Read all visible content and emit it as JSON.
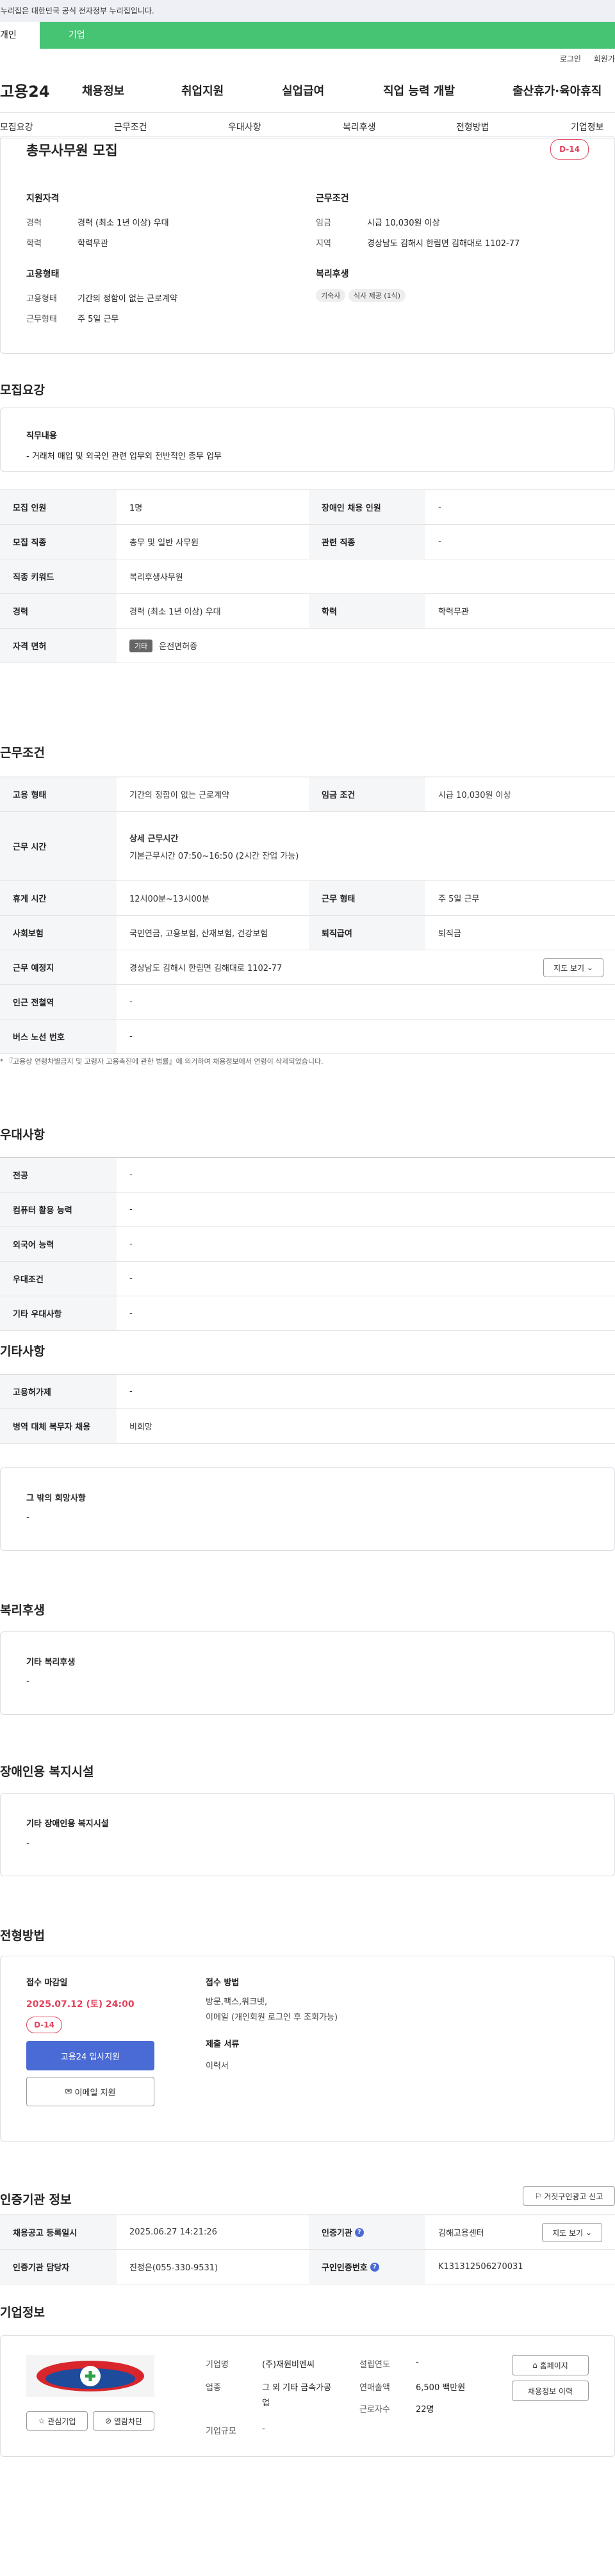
{
  "notice": "이 누리집은 대한민국 공식 전자정부 누리집입니다.",
  "user_tabs": [
    "개인",
    "기업"
  ],
  "util": {
    "login": "로그인",
    "signup": "회원가"
  },
  "logo": "고용24",
  "gnb": [
    "채용정보",
    "취업지원",
    "실업급여",
    "직업 능력 개발",
    "출산휴가·육아휴직"
  ],
  "subnav": [
    "모집요강",
    "근무조건",
    "우대사항",
    "복리후생",
    "전형방법",
    "기업정보"
  ],
  "summary": {
    "title": "총무사무원 모집",
    "dday": "D-14",
    "qual_h": "지원자격",
    "exp_l": "경력",
    "exp_v": "경력 (최소 1년 이상) 우대",
    "edu_l": "학력",
    "edu_v": "학력무관",
    "work_h": "근무조건",
    "wage_l": "임금",
    "wage_v": "시급 10,030원 이상",
    "region_l": "지역",
    "region_v": "경상남도 김해시 한림면 김해대로 1102-77",
    "emp_h": "고용형태",
    "type_l": "고용형태",
    "type_v": "기간의 정함이 없는 근로계약",
    "days_l": "근무형태",
    "days_v": "주 5일 근무",
    "welfare_h": "복리후생",
    "tags": [
      "기숙사",
      "식사 제공 (1식)"
    ]
  },
  "recruit": {
    "title": "모집요강",
    "duty_h": "직무내용",
    "duty_v": "- 거래처 매입 및 외국인 관련 업무외 전반적인 총무 업무",
    "rows": [
      [
        "모집 인원",
        "1명",
        "장애인 채용 인원",
        "-"
      ],
      [
        "모집 직종",
        "총무 및 일반 사무원",
        "관련 직종",
        "-"
      ],
      [
        "직종 키워드",
        "복리후생사무원"
      ],
      [
        "경력",
        "경력 (최소 1년 이상) 우대",
        "학력",
        "학력무관"
      ],
      [
        "자격 면허",
        "운전면허증"
      ]
    ],
    "license_tag": "기타"
  },
  "cond": {
    "title": "근무조건",
    "r1": [
      "고용 형태",
      "기간의 정함이 없는 근로계약",
      "임금 조건",
      "시급 10,030원 이상"
    ],
    "r2_h": "근무 시간",
    "r2_sub": "상세 근무시간",
    "r2_v": "기본근무시간 07:50~16:50 (2시간 잔업 가능)",
    "r3": [
      "휴게 시간",
      "12시00분~13시00분",
      "근무 형태",
      "주 5일 근무"
    ],
    "r4": [
      "사회보험",
      "국민연금, 고용보험, 산재보험, 건강보험",
      "퇴직급여",
      "퇴직금"
    ],
    "r5": [
      "근무 예정지",
      "경상남도 김해시 한림면 김해대로 1102-77"
    ],
    "map": "지도 보기",
    "r6": [
      "인근 전철역",
      "-"
    ],
    "r7": [
      "버스 노선 번호",
      "-"
    ],
    "note": "* 『고용상 연령차별금지 및 고령자 고용촉진에 관한 법률』에 의거하여 채용정보에서 연령이 삭제되었습니다."
  },
  "pref": {
    "title": "우대사항",
    "rows": [
      [
        "전공",
        "-"
      ],
      [
        "컴퓨터 활용 능력",
        "-"
      ],
      [
        "외국어 능력",
        "-"
      ],
      [
        "우대조건",
        "-"
      ],
      [
        "기타 우대사항",
        "-"
      ]
    ]
  },
  "etc": {
    "title": "기타사항",
    "rows": [
      [
        "고용허가제",
        "-"
      ],
      [
        "병역 대체 복무자 채용",
        "비희망"
      ]
    ],
    "hope_h": "그 밖의 희망사항",
    "hope_v": "-"
  },
  "welfare": {
    "title": "복리후생",
    "h": "기타 복리후생",
    "v": "-"
  },
  "disab": {
    "title": "장애인용 복지시설",
    "h": "기타 장애인용 복지시설",
    "v": "-"
  },
  "process": {
    "title": "전형방법",
    "deadline_h": "접수 마감일",
    "deadline": "2025.07.12 (토) 24:00",
    "dday": "D-14",
    "apply": "고용24 입사지원",
    "email": "이메일 지원",
    "method_h": "접수 방법",
    "method_v1": "방문,팩스,워크넷,",
    "method_v2": "이메일 (개인회원 로그인 후 조회가능)",
    "docs_h": "제출 서류",
    "docs_v": "이력서"
  },
  "agency": {
    "title": "인증기관 정보",
    "report": "거짓구인광고 신고",
    "r1": [
      "채용공고 등록일시",
      "2025.06.27 14:21:26",
      "인증기관",
      "김해고용센터"
    ],
    "map": "지도 보기",
    "r2": [
      "인증기관 담당자",
      "진정은(055-330-9531)",
      "구인인증번호",
      "K131312506270031"
    ]
  },
  "company": {
    "title": "기업정보",
    "fav": "관심기업",
    "block": "열람차단",
    "name_l": "기업명",
    "name_v": "(주)재원비엔씨",
    "ind_l": "업종",
    "ind_v": "그 외 기타 금속가공업",
    "size_l": "기업규모",
    "size_v": "-",
    "year_l": "설립연도",
    "year_v": "-",
    "sales_l": "연매출액",
    "sales_v": "6,500 백만원",
    "emp_l": "근로자수",
    "emp_v": "22명",
    "home": "홈페이지",
    "history": "채용정보 이력"
  }
}
